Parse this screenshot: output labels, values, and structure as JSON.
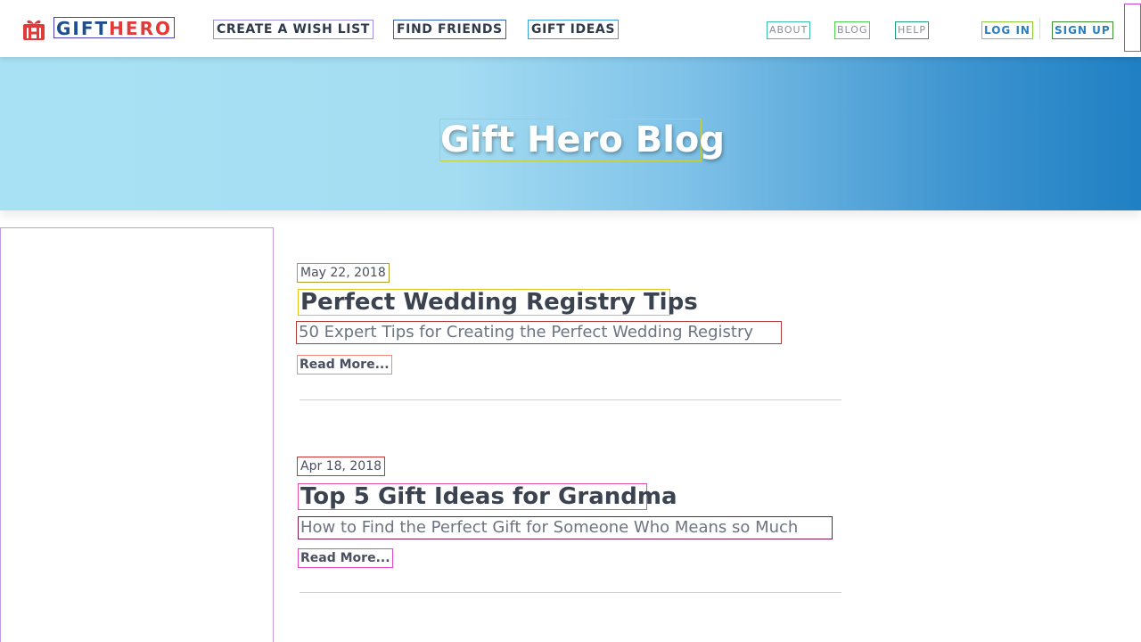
{
  "header": {
    "logo": {
      "gift": "GIFT",
      "hero": "HERO"
    },
    "nav_main": {
      "create": "CREATE A WISH LIST",
      "find": "FIND FRIENDS",
      "ideas": "GIFT IDEAS"
    },
    "nav_secondary": {
      "about": "ABOUT",
      "blog": "BLOG",
      "help": "HELP",
      "login": "LOG IN",
      "signup": "SIGN UP"
    }
  },
  "hero": {
    "title": "Gift Hero Blog"
  },
  "posts": [
    {
      "date": "May 22, 2018",
      "title": "Perfect Wedding Registry Tips",
      "subtitle": "50 Expert Tips for Creating the Perfect Wedding Registry",
      "read_more": "Read More..."
    },
    {
      "date": "Apr 18, 2018",
      "title": "Top 5 Gift Ideas for Grandma",
      "subtitle": "How to Find the Perfect Gift for Someone Who Means so Much",
      "read_more": "Read More..."
    }
  ],
  "colors": {
    "brand_red": "#e03a3a",
    "brand_blue": "#1f4e8c",
    "hero_gradient_start": "#a9e1f4",
    "hero_gradient_end": "#1f80c3"
  }
}
